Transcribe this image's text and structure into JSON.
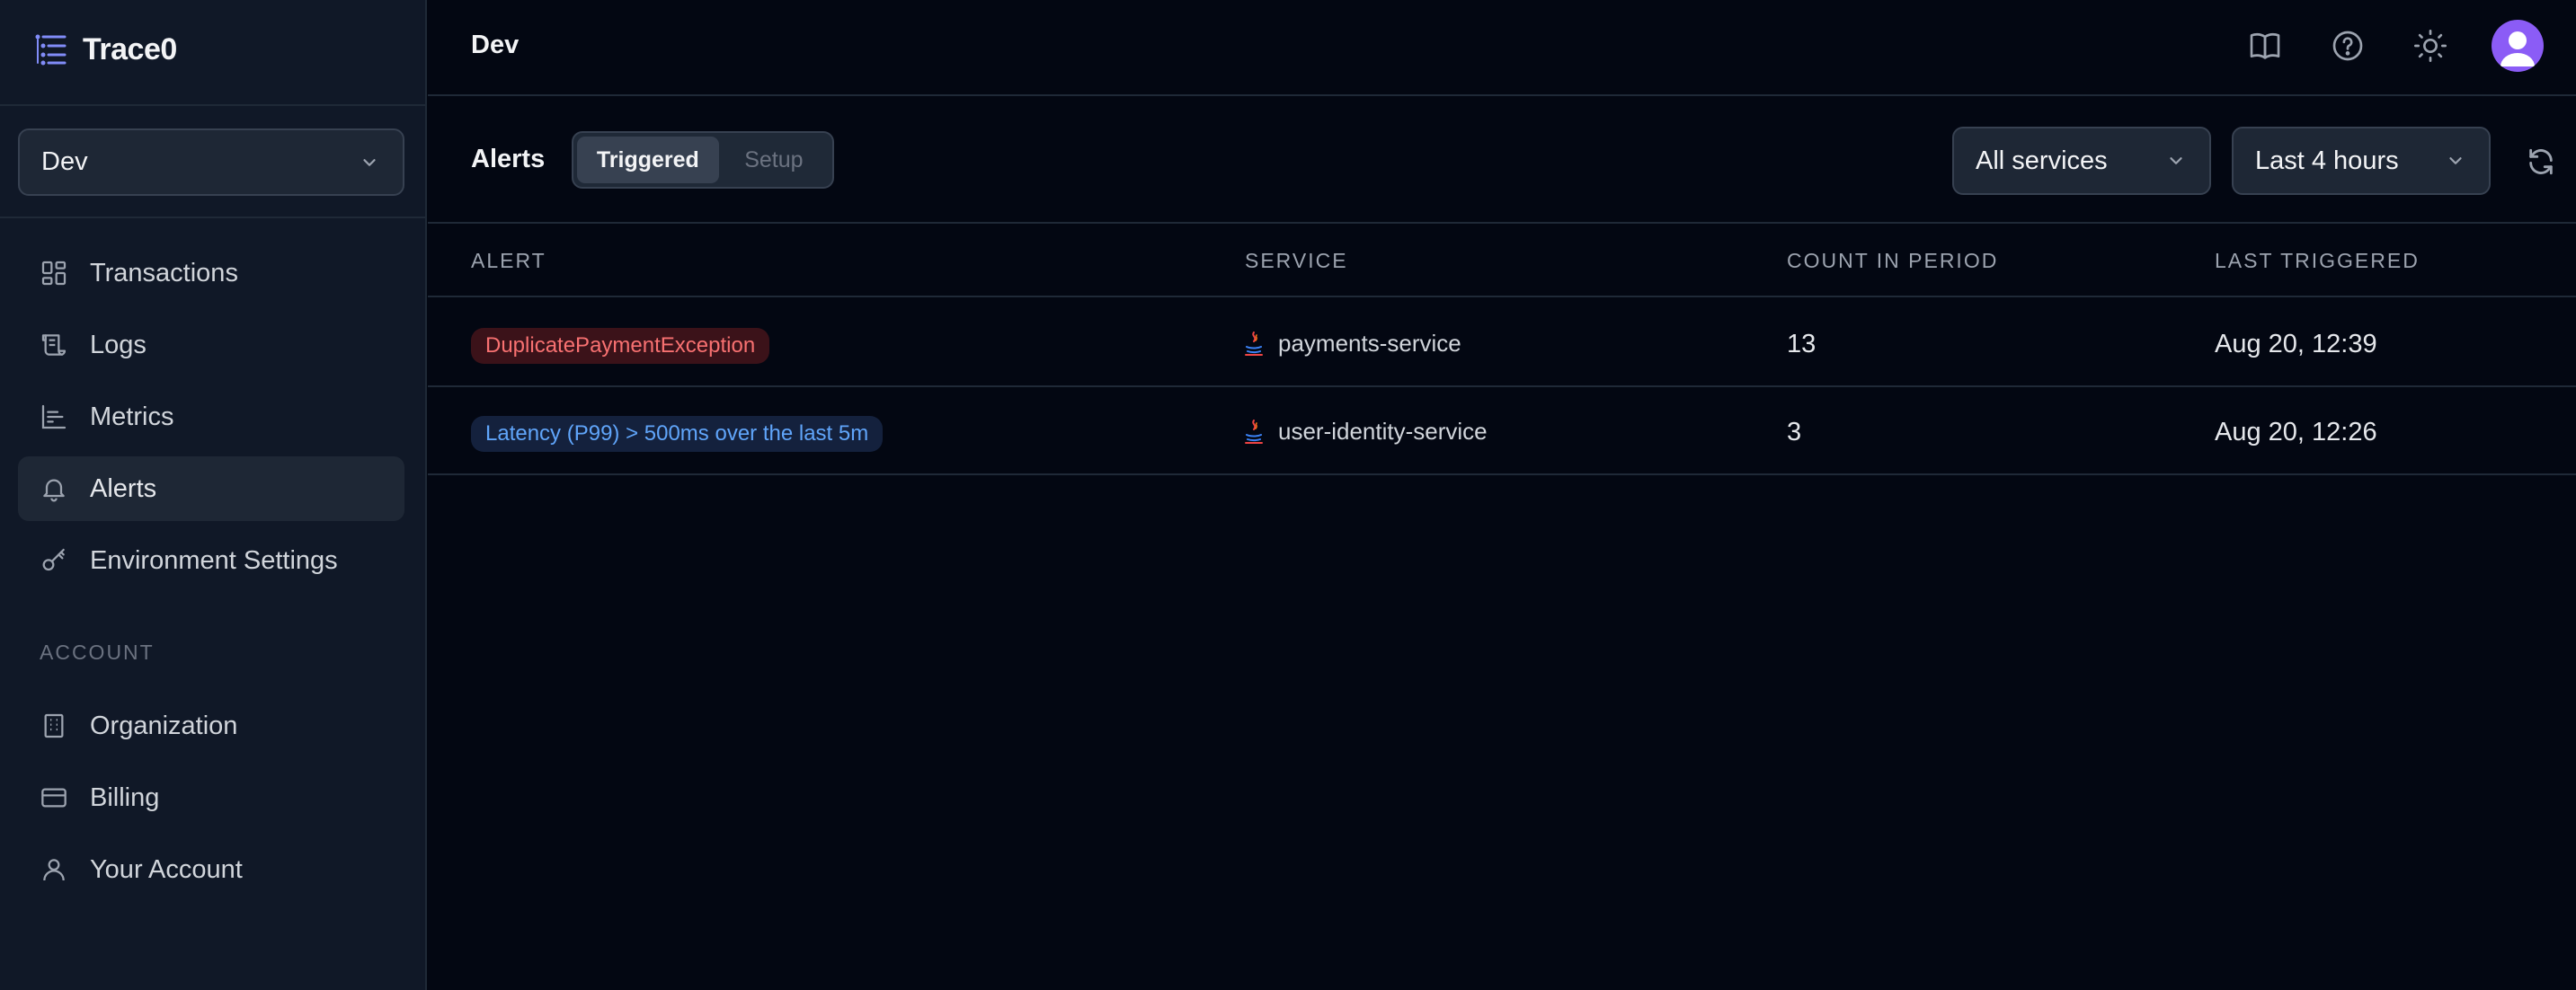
{
  "app": {
    "name": "Trace0"
  },
  "environment": {
    "selected": "Dev"
  },
  "sidebar": {
    "items": [
      {
        "label": "Transactions",
        "icon": "dashboard-grid-icon"
      },
      {
        "label": "Logs",
        "icon": "scroll-icon"
      },
      {
        "label": "Metrics",
        "icon": "bar-chart-icon"
      },
      {
        "label": "Alerts",
        "icon": "bell-icon",
        "active": true
      },
      {
        "label": "Environment Settings",
        "icon": "key-icon"
      }
    ],
    "account_section": "ACCOUNT",
    "account_items": [
      {
        "label": "Organization",
        "icon": "building-icon"
      },
      {
        "label": "Billing",
        "icon": "credit-card-icon"
      },
      {
        "label": "Your Account",
        "icon": "user-icon"
      }
    ]
  },
  "header": {
    "breadcrumb": "Dev",
    "icons": [
      "book-icon",
      "help-circle-icon",
      "sun-icon",
      "avatar"
    ]
  },
  "toolbar": {
    "title": "Alerts",
    "tabs": [
      {
        "label": "Triggered",
        "active": true
      },
      {
        "label": "Setup",
        "active": false
      }
    ],
    "service_filter": "All services",
    "time_filter": "Last 4 hours"
  },
  "table": {
    "columns": [
      "ALERT",
      "SERVICE",
      "COUNT IN PERIOD",
      "LAST TRIGGERED"
    ],
    "rows": [
      {
        "alert": "DuplicatePaymentException",
        "alert_style": "error",
        "service": "payments-service",
        "count": "13",
        "last_triggered": "Aug 20, 12:39"
      },
      {
        "alert": "Latency (P99) > 500ms over the last 5m",
        "alert_style": "info",
        "service": "user-identity-service",
        "count": "3",
        "last_triggered": "Aug 20, 12:26"
      }
    ]
  },
  "colors": {
    "background": "#030712",
    "sidebar": "#101827",
    "accent": "#8b5cf6",
    "error_badge_text": "#f87171",
    "info_badge_text": "#60a5fa"
  }
}
